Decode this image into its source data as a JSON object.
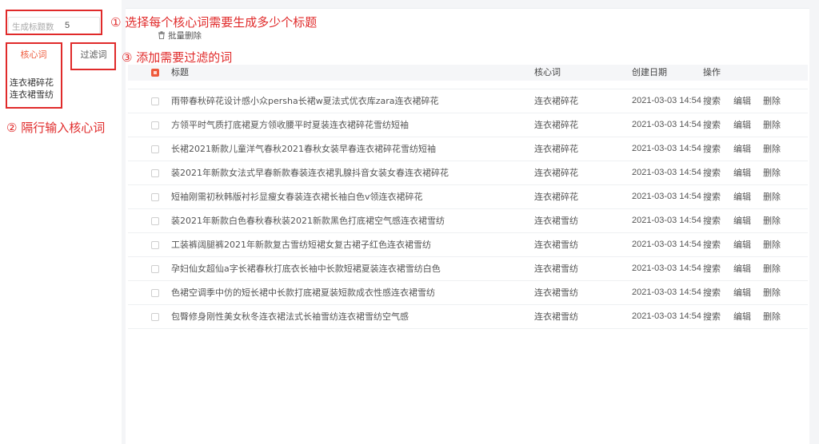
{
  "settings": {
    "count_label": "生成标题数",
    "count_value": "5"
  },
  "tabs": [
    {
      "label": "核心词",
      "active": true
    },
    {
      "label": "过滤词",
      "active": false
    }
  ],
  "keywords": {
    "text": "连衣裙碎花\n连衣裙雪纺"
  },
  "toolbar": {
    "batch_delete_label": "批量删除",
    "batch_delete_icon": "trash-icon"
  },
  "table": {
    "select_all_checked": true,
    "headers": {
      "title": "标题",
      "keyword": "核心词",
      "date": "创建日期",
      "actions": "操作"
    },
    "actions": {
      "search": "搜索",
      "edit": "编辑",
      "delete": "删除"
    },
    "rows": [
      {
        "title": "雨带春秋碎花设计感小众persha长裙w夏法式优衣库zara连衣裙碎花",
        "keyword": "连衣裙碎花",
        "date": "2021-03-03 14:54"
      },
      {
        "title": "方领平时气质打底裙夏方领收腰平时夏装连衣裙碎花雪纺短袖",
        "keyword": "连衣裙碎花",
        "date": "2021-03-03 14:54"
      },
      {
        "title": "长裙2021新款儿童洋气春秋2021春秋女装早春连衣裙碎花雪纺短袖",
        "keyword": "连衣裙碎花",
        "date": "2021-03-03 14:54"
      },
      {
        "title": "装2021年新款女法式早春新款春装连衣裙乳腺抖音女装女春连衣裙碎花",
        "keyword": "连衣裙碎花",
        "date": "2021-03-03 14:54"
      },
      {
        "title": "短袖刚需初秋韩版衬衫显瘦女春装连衣裙长袖白色v领连衣裙碎花",
        "keyword": "连衣裙碎花",
        "date": "2021-03-03 14:54"
      },
      {
        "title": "装2021年新款白色春秋春秋装2021新款黑色打底裙空气感连衣裙雪纺",
        "keyword": "连衣裙雪纺",
        "date": "2021-03-03 14:54"
      },
      {
        "title": "工装裤阔腿裤2021年新款复古雪纺短裙女复古裙子红色连衣裙雪纺",
        "keyword": "连衣裙雪纺",
        "date": "2021-03-03 14:54"
      },
      {
        "title": "孕妇仙女超仙a字长裙春秋打底衣长袖中长款短裙夏装连衣裙雪纺白色",
        "keyword": "连衣裙雪纺",
        "date": "2021-03-03 14:54"
      },
      {
        "title": "色裙空调季中仿的短长裙中长款打底裙夏装短款成衣性感连衣裙雪纺",
        "keyword": "连衣裙雪纺",
        "date": "2021-03-03 14:54"
      },
      {
        "title": "包臀修身刚性美女秋冬连衣裙法式长袖雪纺连衣裙雪纺空气感",
        "keyword": "连衣裙雪纺",
        "date": "2021-03-03 14:54"
      }
    ]
  },
  "annotations": {
    "step1": "① 选择每个核心词需要生成多少个标题",
    "step2": "② 隔行输入核心词",
    "step3": "③ 添加需要过滤的词"
  },
  "colors": {
    "accent": "#ee5a3c",
    "annotation": "#e02a2a"
  }
}
